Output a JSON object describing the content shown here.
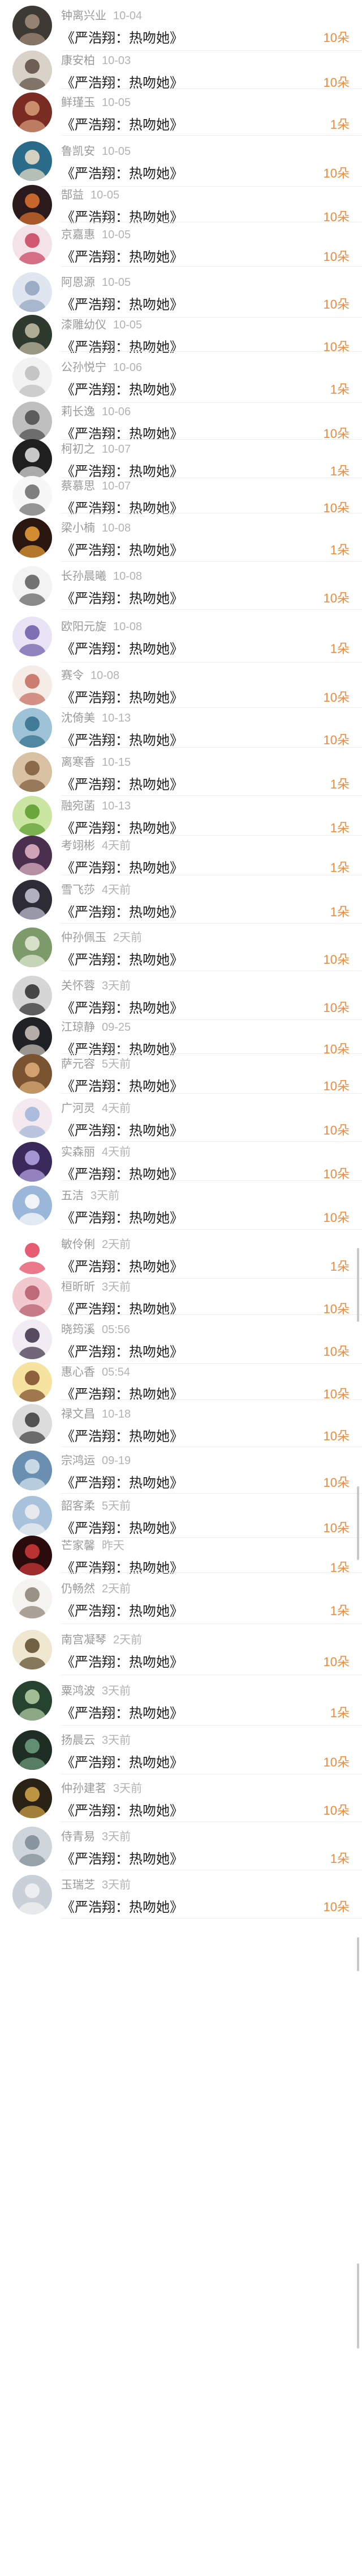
{
  "gift_list": {
    "rows": [
      {
        "name": "钟离兴业",
        "time": "10-04",
        "title": "《严浩翔：热吻她》",
        "amount": "10朵",
        "avatar": "dark-portrait-avatar"
      },
      {
        "name": "康安柏",
        "time": "10-03",
        "title": "《严浩翔：热吻她》",
        "amount": "10朵",
        "avatar": "girl-portrait-avatar"
      },
      {
        "name": "鲜瑾玉",
        "time": "10-05",
        "title": "《严浩翔：热吻她》",
        "amount": "1朵",
        "avatar": "red-tone-avatar"
      },
      {
        "name": "鲁凯安",
        "time": "10-05",
        "title": "《严浩翔：热吻她》",
        "amount": "10朵",
        "avatar": "cartoon-avatar"
      },
      {
        "name": "郜益",
        "time": "10-05",
        "title": "《严浩翔：热吻她》",
        "amount": "10朵",
        "avatar": "night-scene-avatar"
      },
      {
        "name": "京嘉惠",
        "time": "10-05",
        "title": "《严浩翔：热吻她》",
        "amount": "10朵",
        "avatar": "flower-avatar"
      },
      {
        "name": "阿恩源",
        "time": "10-05",
        "title": "《严浩翔：热吻她》",
        "amount": "10朵",
        "avatar": "pale-sky-avatar"
      },
      {
        "name": "漆雕幼仪",
        "time": "10-05",
        "title": "《严浩翔：热吻她》",
        "amount": "10朵",
        "avatar": "landscape-avatar"
      },
      {
        "name": "公孙悦宁",
        "time": "10-06",
        "title": "《严浩翔：热吻她》",
        "amount": "1朵",
        "avatar": "white-flower-avatar"
      },
      {
        "name": "莉长逸",
        "time": "10-06",
        "title": "《严浩翔：热吻她》",
        "amount": "10朵",
        "avatar": "bw-portrait-avatar"
      },
      {
        "name": "柯初之",
        "time": "10-07",
        "title": "《严浩翔：热吻她》",
        "amount": "1朵",
        "avatar": "masked-face-avatar"
      },
      {
        "name": "蔡慕思",
        "time": "10-07",
        "title": "《严浩翔：热吻她》",
        "amount": "10朵",
        "avatar": "sketch-avatar"
      },
      {
        "name": "梁小楠",
        "time": "10-08",
        "title": "《严浩翔：热吻她》",
        "amount": "1朵",
        "avatar": "lights-avatar"
      },
      {
        "name": "长孙晨曦",
        "time": "10-08",
        "title": "《严浩翔：热吻她》",
        "amount": "10朵",
        "avatar": "cat-avatar"
      },
      {
        "name": "欧阳元旋",
        "time": "10-08",
        "title": "《严浩翔：热吻她》",
        "amount": "1朵",
        "avatar": "anime-avatar"
      },
      {
        "name": "赛令",
        "time": "10-08",
        "title": "《严浩翔：热吻她》",
        "amount": "10朵",
        "avatar": "figure-avatar"
      },
      {
        "name": "沈倚美",
        "time": "10-13",
        "title": "《严浩翔：热吻她》",
        "amount": "10朵",
        "avatar": "sea-avatar"
      },
      {
        "name": "离寒香",
        "time": "10-15",
        "title": "《严浩翔：热吻她》",
        "amount": "1朵",
        "avatar": "warm-portrait-avatar"
      },
      {
        "name": "融宛菡",
        "time": "10-13",
        "title": "《严浩翔：热吻她》",
        "amount": "1朵",
        "avatar": "lime-avatar"
      },
      {
        "name": "考翊彬",
        "time": "4天前",
        "title": "《严浩翔：热吻她》",
        "amount": "1朵",
        "avatar": "purple-portrait-avatar"
      },
      {
        "name": "雪飞莎",
        "time": "4天前",
        "title": "《严浩翔：热吻她》",
        "amount": "1朵",
        "avatar": "dark-anime-avatar"
      },
      {
        "name": "仲孙佩玉",
        "time": "2天前",
        "title": "《严浩翔：热吻她》",
        "amount": "10朵",
        "avatar": "green-avatar"
      },
      {
        "name": "关怀蓉",
        "time": "3天前",
        "title": "《严浩翔：热吻她》",
        "amount": "10朵",
        "avatar": "camera-avatar"
      },
      {
        "name": "江琼静",
        "time": "09-25",
        "title": "《严浩翔：热吻她》",
        "amount": "10朵",
        "avatar": "dark-suit-avatar"
      },
      {
        "name": "萨元容",
        "time": "5天前",
        "title": "《严浩翔：热吻她》",
        "amount": "10朵",
        "avatar": "brown-avatar"
      },
      {
        "name": "广河灵",
        "time": "4天前",
        "title": "《严浩翔：热吻她》",
        "amount": "10朵",
        "avatar": "pastel-avatar"
      },
      {
        "name": "实森丽",
        "time": "4天前",
        "title": "《严浩翔：热吻她》",
        "amount": "10朵",
        "avatar": "violet-avatar"
      },
      {
        "name": "五洁",
        "time": "3天前",
        "title": "《严浩翔：热吻她》",
        "amount": "10朵",
        "avatar": "blue-avatar"
      },
      {
        "name": "敏伶俐",
        "time": "2天前",
        "title": "《严浩翔：热吻她》",
        "amount": "1朵",
        "avatar": "lollipop-avatar"
      },
      {
        "name": "桓昕昕",
        "time": "3天前",
        "title": "《严浩翔：热吻她》",
        "amount": "10朵",
        "avatar": "pink-avatar"
      },
      {
        "name": "晓筠溪",
        "time": "05:56",
        "title": "《严浩翔：热吻她》",
        "amount": "10朵",
        "avatar": "doll-avatar"
      },
      {
        "name": "惠心香",
        "time": "05:54",
        "title": "《严浩翔：热吻她》",
        "amount": "10朵",
        "avatar": "yellow-anime-avatar"
      },
      {
        "name": "禄文昌",
        "time": "10-18",
        "title": "《严浩翔：热吻她》",
        "amount": "10朵",
        "avatar": "mono-portrait-avatar"
      },
      {
        "name": "宗鸿运",
        "time": "09-19",
        "title": "《严浩翔：热吻她》",
        "amount": "10朵",
        "avatar": "ocean-avatar"
      },
      {
        "name": "韶客柔",
        "time": "5天前",
        "title": "《严浩翔：热吻她》",
        "amount": "10朵",
        "avatar": "sky-avatar"
      },
      {
        "name": "芒家馨",
        "time": "昨天",
        "title": "《严浩翔：热吻她》",
        "amount": "1朵",
        "avatar": "red-heart-avatar"
      },
      {
        "name": "仍畅然",
        "time": "2天前",
        "title": "《严浩翔：热吻她》",
        "amount": "1朵",
        "avatar": "sketch-girl-avatar"
      },
      {
        "name": "南宫凝琴",
        "time": "2天前",
        "title": "《严浩翔：热吻她》",
        "amount": "10朵",
        "avatar": "text-badge-avatar"
      },
      {
        "name": "粟鸿波",
        "time": "3天前",
        "title": "《严浩翔：热吻她》",
        "amount": "1朵",
        "avatar": "forest-avatar"
      },
      {
        "name": "扬晨云",
        "time": "3天前",
        "title": "《严浩翔：热吻她》",
        "amount": "10朵",
        "avatar": "dark-green-avatar"
      },
      {
        "name": "仲孙建茗",
        "time": "3天前",
        "title": "《严浩翔：热吻她》",
        "amount": "10朵",
        "avatar": "gold-avatar"
      },
      {
        "name": "侍青易",
        "time": "3天前",
        "title": "《严浩翔：热吻她》",
        "amount": "1朵",
        "avatar": "mist-avatar"
      },
      {
        "name": "玉瑞芝",
        "time": "3天前",
        "title": "《严浩翔：热吻她》",
        "amount": "10朵",
        "avatar": "faded-avatar"
      }
    ]
  },
  "colors": {
    "amount": "#f08a3c",
    "title": "#222222",
    "meta": "#9a9a9a",
    "divider": "#ededed"
  }
}
